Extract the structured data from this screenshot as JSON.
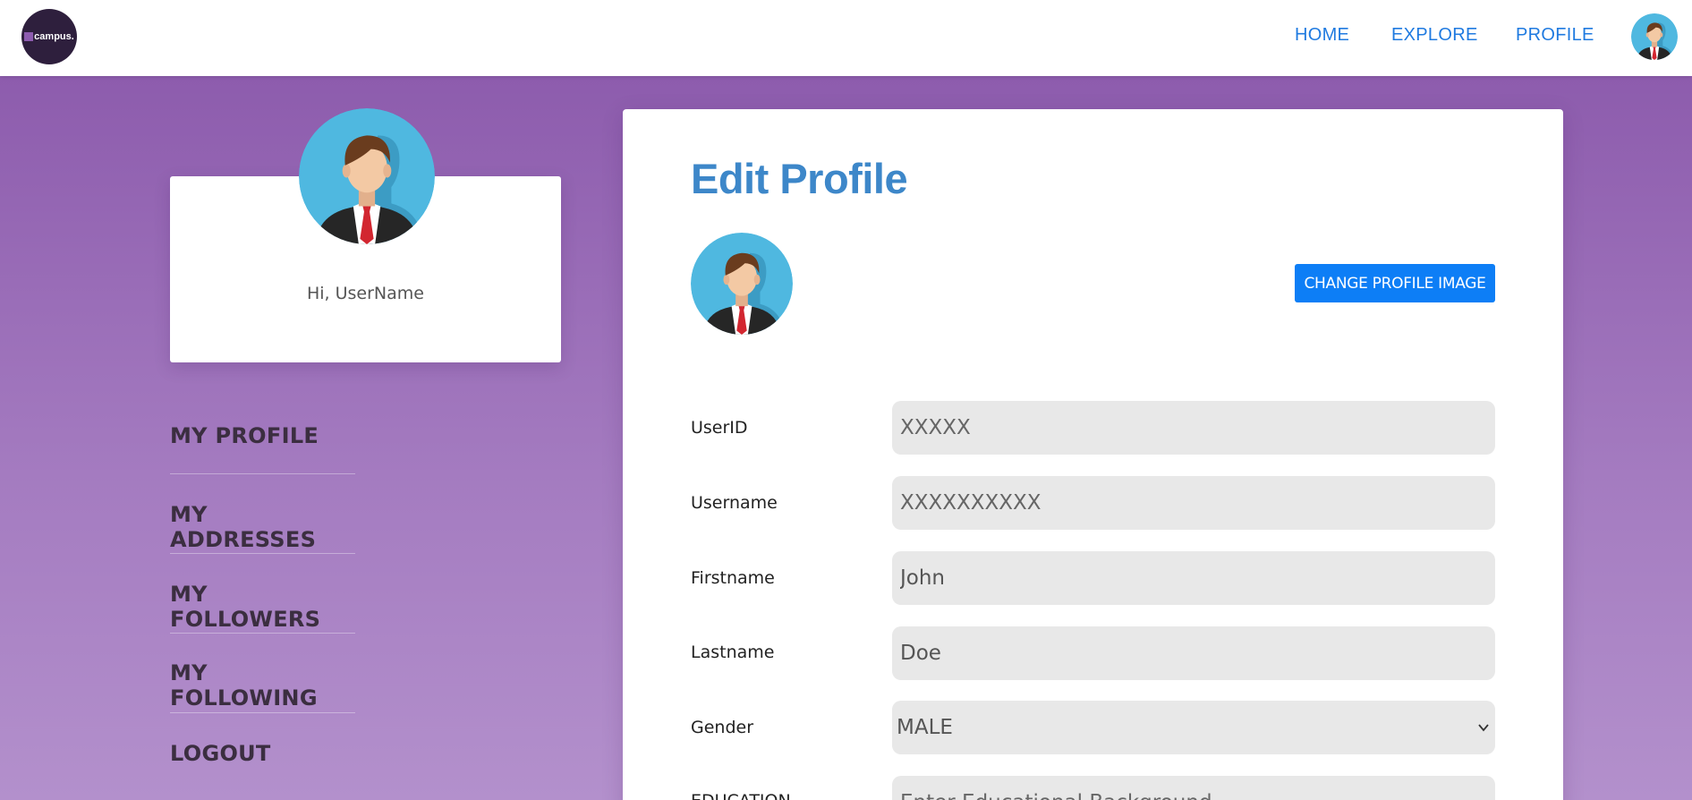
{
  "header": {
    "logo_text": "campus.",
    "nav": [
      {
        "label": "HOME"
      },
      {
        "label": "EXPLORE"
      },
      {
        "label": "PROFILE"
      }
    ],
    "avatar_icon": "user-avatar-icon"
  },
  "sidebar": {
    "greeting": "Hi, UserName",
    "avatar_icon": "user-avatar-icon",
    "menu": [
      {
        "label": "MY PROFILE"
      },
      {
        "label": "MY ADDRESSES"
      },
      {
        "label": "MY FOLLOWERS"
      },
      {
        "label": "MY FOLLOWING"
      },
      {
        "label": "LOGOUT"
      }
    ]
  },
  "main": {
    "title": "Edit Profile",
    "change_image_label": "CHANGE PROFILE IMAGE",
    "fields": {
      "userid": {
        "label": "UserID",
        "placeholder": "XXXXX"
      },
      "username": {
        "label": "Username",
        "placeholder": "XXXXXXXXXX"
      },
      "firstname": {
        "label": "Firstname",
        "value": "John"
      },
      "lastname": {
        "label": "Lastname",
        "value": "Doe"
      },
      "gender": {
        "label": "Gender",
        "selected": "MALE"
      },
      "education": {
        "label": "EDUCATION",
        "placeholder": "Enter Educational Background"
      }
    }
  },
  "colors": {
    "nav_link": "#1f7ae0",
    "title": "#3d87c9",
    "button": "#0d7ef6",
    "background_top": "#8d5cad",
    "background_bottom": "#b390cc"
  }
}
